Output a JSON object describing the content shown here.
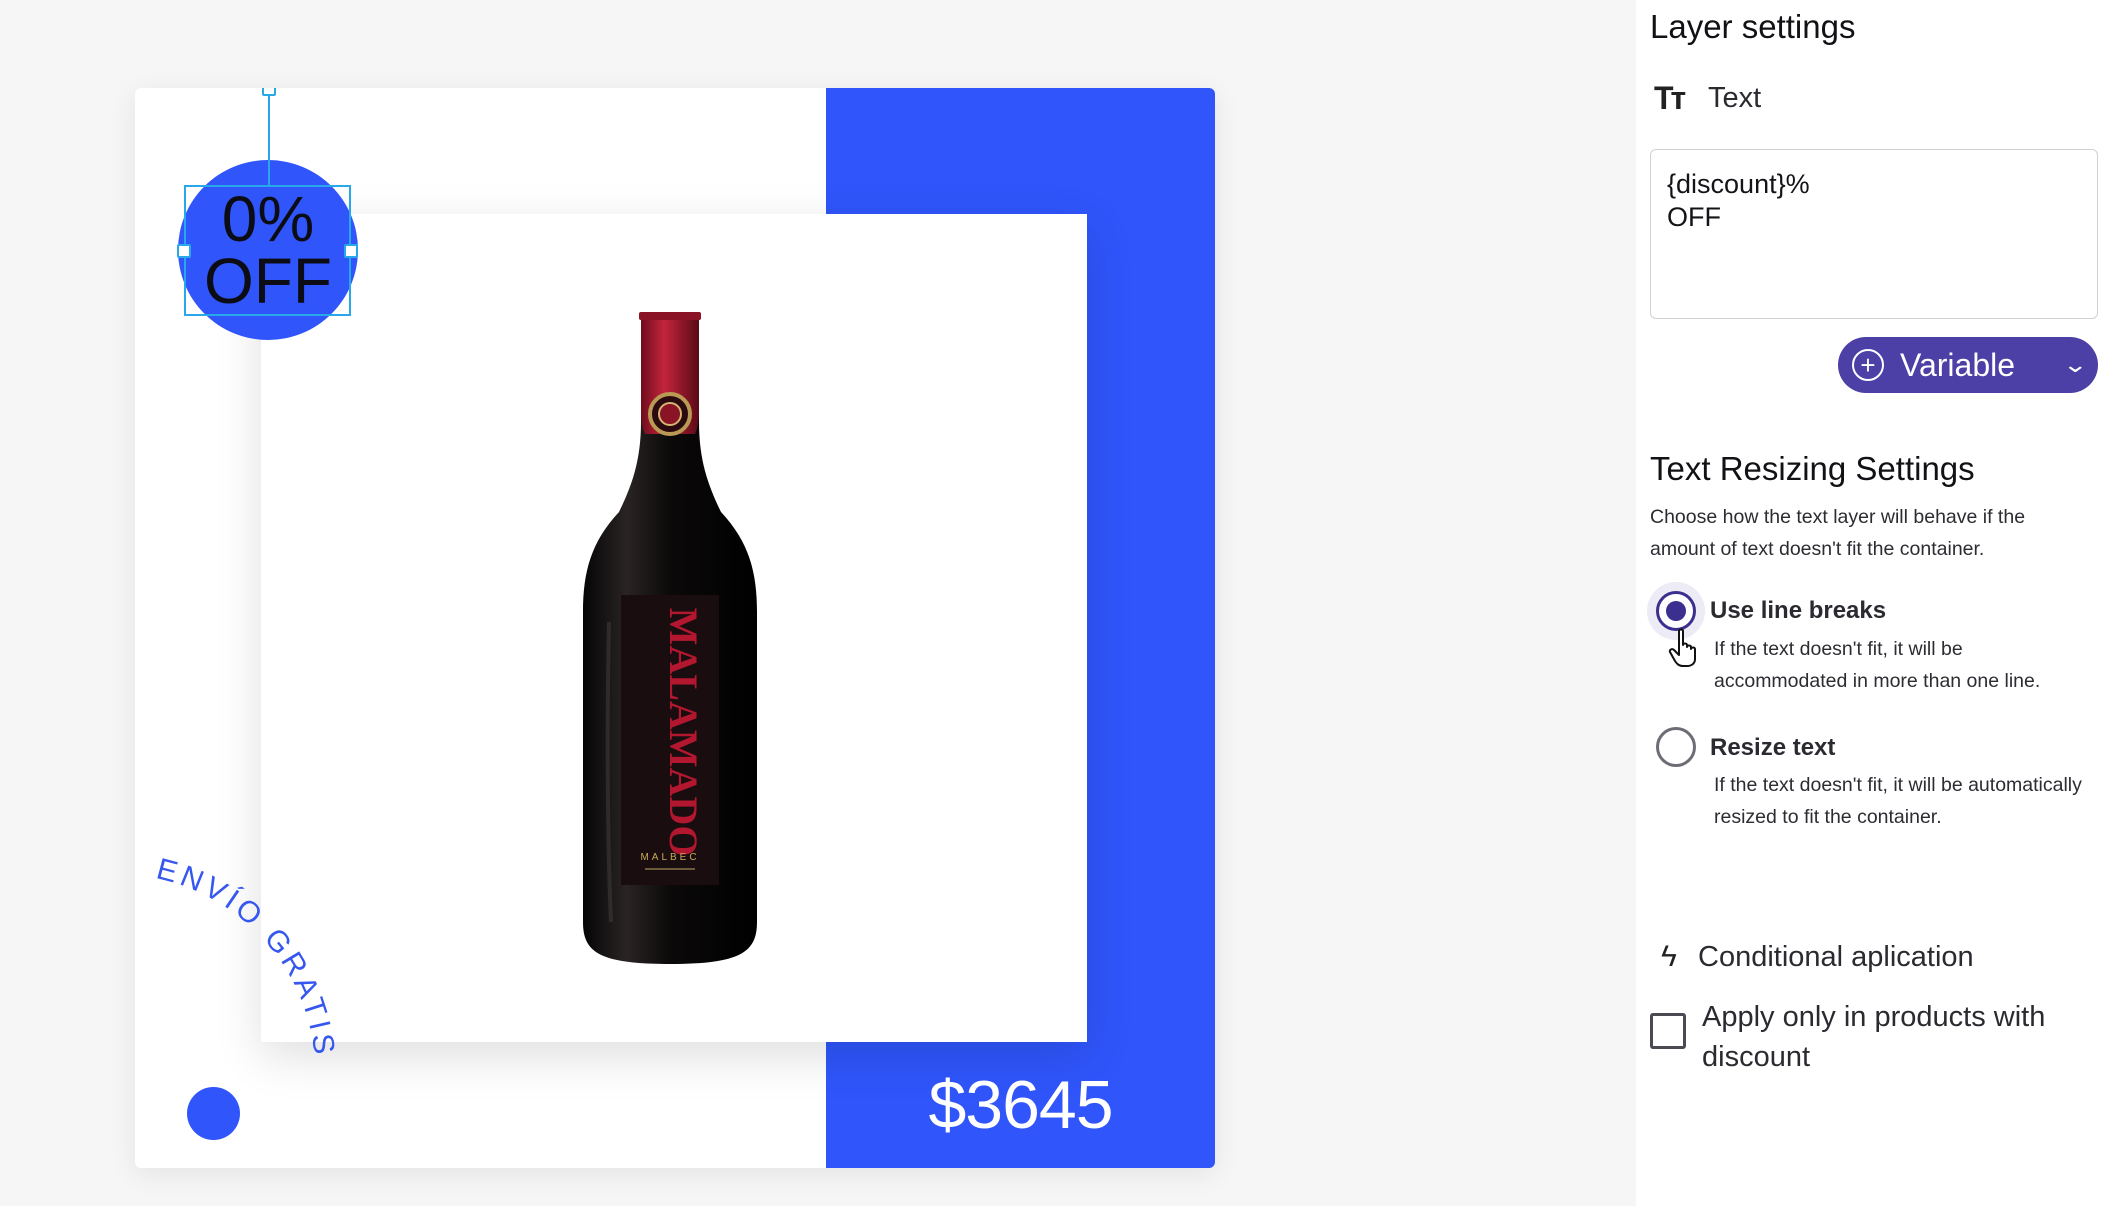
{
  "canvas": {
    "badge_line1": "0%",
    "badge_line2": "OFF",
    "arc_text": "ENVÍO GRATIS",
    "price": "$3645",
    "bottle_label": "MALAMADO",
    "bottle_sublabel": "MALBEC",
    "brand_color": "#2f55fb"
  },
  "panel": {
    "title": "Layer settings",
    "text_section": {
      "icon": "text-format-icon",
      "label": "Text"
    },
    "textarea_value": "{discount}%\nOFF",
    "variable_button": {
      "icon": "plus-circle-icon",
      "label": "Variable",
      "chevron": "chevron-down-icon"
    },
    "resizing": {
      "title": "Text Resizing Settings",
      "description": "Choose how the text layer will behave if the amount of text doesn't fit the container.",
      "options": [
        {
          "label": "Use line breaks",
          "description": "If the text doesn't fit, it will be accommodated in more than one line.",
          "selected": true
        },
        {
          "label": "Resize text",
          "description": "If the text doesn't fit, it will be automatically resized to fit the container.",
          "selected": false
        }
      ]
    },
    "conditional": {
      "icon": "lightning-icon",
      "label": "Conditional aplication",
      "checkbox_label": "Apply only in products with discount",
      "checked": false
    },
    "accent_color": "#4c3fa6"
  }
}
